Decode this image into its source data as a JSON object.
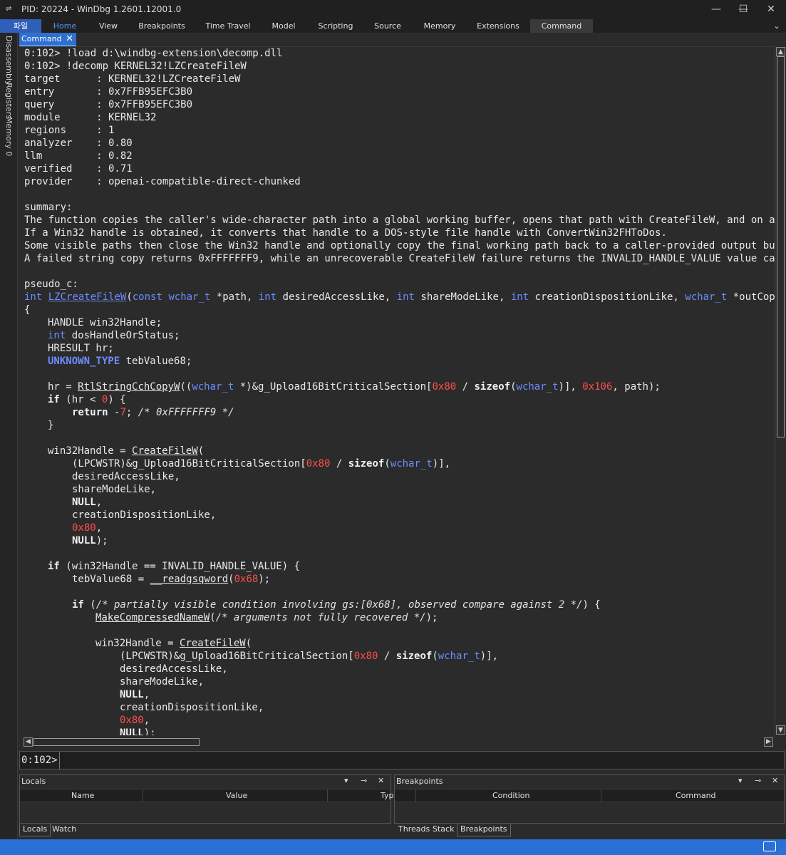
{
  "window": {
    "title": "PID: 20224 - WinDbg 1.2601.12001.0",
    "minimize": "—",
    "maximize": "☐",
    "close": "✕"
  },
  "ribbon": {
    "tabs": [
      "파일",
      "Home",
      "View",
      "Breakpoints",
      "Time Travel",
      "Model",
      "Scripting",
      "Source",
      "Memory",
      "Extensions",
      "Command"
    ],
    "active": "Home",
    "collapse_icon": "chevron-down-icon"
  },
  "sidebar": {
    "tabs": [
      "Disassembly",
      "Registers",
      "Memory 0"
    ]
  },
  "document_tab": {
    "label": "Command",
    "close": "✕"
  },
  "output": {
    "lines": [
      "0:102> !load d:\\windbg-extension\\decomp.dll",
      "0:102> !decomp KERNEL32!LZCreateFileW",
      "target      : KERNEL32!LZCreateFileW",
      "entry       : 0x7FFB95EFC3B0",
      "query       : 0x7FFB95EFC3B0",
      "module      : KERNEL32",
      "regions     : 1",
      "analyzer    : 0.80",
      "llm         : 0.82",
      "verified    : 0.71",
      "provider    : openai-compatible-direct-chunked",
      "",
      "summary:",
      "The function copies the caller's wide-character path into a global working buffer, opens that path with CreateFileW, and on a",
      "If a Win32 handle is obtained, it converts that handle to a DOS-style file handle with ConvertWin32FHToDos.",
      "Some visible paths then close the Win32 handle and optionally copy the final working path back to a caller-provided output bu",
      "A failed string copy returns 0xFFFFFFF9, while an unrecoverable CreateFileW failure returns the INVALID_HANDLE_VALUE value ca",
      "",
      "pseudo_c:"
    ],
    "code": {
      "sig_int": "int",
      "sig_name": "LZCreateFileW",
      "sig_open": "(",
      "sig_const": "const",
      "sig_wchar": "wchar_t",
      "sig_p1": " *path, ",
      "sig_int2": "int",
      "sig_p2": " desiredAccessLike, ",
      "sig_int3": "int",
      "sig_p3": " shareModeLike, ",
      "sig_int4": "int",
      "sig_p4": " creationDispositionLike, ",
      "sig_wchar2": "wchar_t",
      "sig_p5": " *outCop",
      "brace_open": "{",
      "decl1": "HANDLE win32Handle;",
      "decl2_type": "int",
      "decl2_rest": " dosHandleOrStatus;",
      "decl3": "HRESULT hr;",
      "decl4_type": "UNKNOWN_TYPE",
      "decl4_rest": " tebValue68;",
      "hr_assign": "hr = ",
      "hr_fn": "RtlStringCchCopyW",
      "hr_cast_open": "((",
      "hr_wchar": "wchar_t",
      "hr_cast_rest": " *)&g_Upload16BitCriticalSection[",
      "hr_0x80": "0x80",
      "hr_div": " / ",
      "hr_sizeof": "sizeof",
      "hr_paren": "(",
      "hr_wchar2": "wchar_t",
      "hr_close": ")], ",
      "hr_0x106": "0x106",
      "hr_end": ", path);",
      "if1_kw": "if",
      "if1_a": " (hr < ",
      "if1_zero": "0",
      "if1_b": ") {",
      "ret_kw": "return",
      "ret_a": " -",
      "ret_num": "7",
      "ret_b": "; ",
      "ret_cmt": "/* 0xFFFFFFF9 */",
      "brace_close": "}",
      "cf1_a": "win32Handle = ",
      "cf_fn": "CreateFileW",
      "cf_open": "(",
      "cast_a": "(LPCWSTR)&g_Upload16BitCriticalSection[",
      "cast_0x80": "0x80",
      "cast_div": " / ",
      "cast_sizeof": "sizeof",
      "cast_paren": "(",
      "cast_wchar": "wchar_t",
      "cast_close": ")],",
      "cast_close2": ")],",
      "arg_access": "desiredAccessLike,",
      "arg_share": "shareModeLike,",
      "arg_null": "NULL",
      "comma": ",",
      "arg_disp": "creationDispositionLike,",
      "arg_0x80": "0x80",
      "arg_null_end": ");",
      "if2_kw": "if",
      "if2_a": " (win32Handle == INVALID_HANDLE_VALUE) {",
      "teb_a": "tebValue68 = ",
      "teb_fn": "__readgsqword",
      "teb_open": "(",
      "teb_num": "0x68",
      "teb_close": ");",
      "if3_kw": "if",
      "if3_a": " (",
      "if3_cmt": "/* partially visible condition involving gs:[0x68], observed compare against 2 */",
      "if3_b": ") {",
      "mcn_fn": "MakeCompressedNameW",
      "mcn_a": "(",
      "mcn_cmt": "/* arguments not fully recovered */",
      "mcn_b": ");",
      "cf2_a": "win32Handle = "
    }
  },
  "command_input": {
    "prompt": "0:102>"
  },
  "locals_panel": {
    "title": "Locals",
    "columns": [
      "Name",
      "Value",
      "Typ"
    ],
    "tabs": [
      "Locals",
      "Watch"
    ]
  },
  "breakpoints_panel": {
    "title": "Breakpoints",
    "columns": [
      "Condition",
      "Command"
    ],
    "tabs": [
      "Threads",
      "Stack",
      "Breakpoints"
    ]
  },
  "panel_controls": {
    "dropdown": "▾",
    "pin": "⊸",
    "close": "✕"
  },
  "colors": {
    "accent": "#2a6fd6",
    "keyword": "#6b8cff",
    "number": "#ff4d4d"
  }
}
